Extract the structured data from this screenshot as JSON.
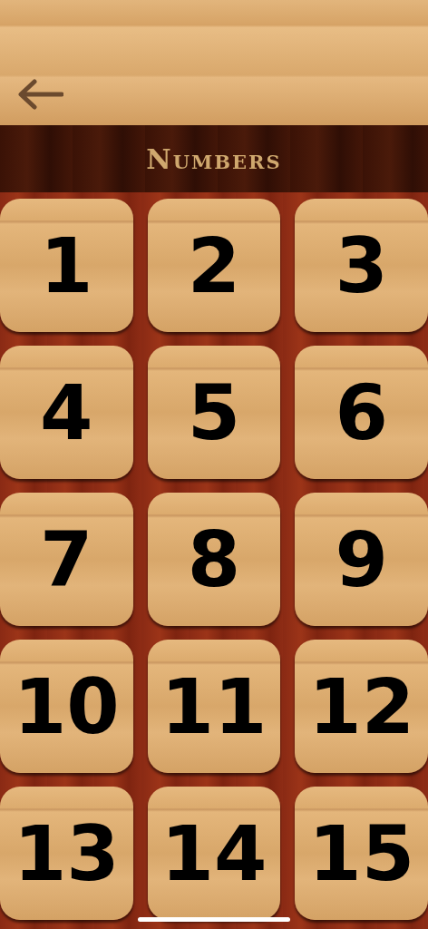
{
  "header": {
    "title": "Numbers"
  },
  "tiles": [
    "1",
    "2",
    "3",
    "4",
    "5",
    "6",
    "7",
    "8",
    "9",
    "10",
    "11",
    "12",
    "13",
    "14",
    "15"
  ]
}
